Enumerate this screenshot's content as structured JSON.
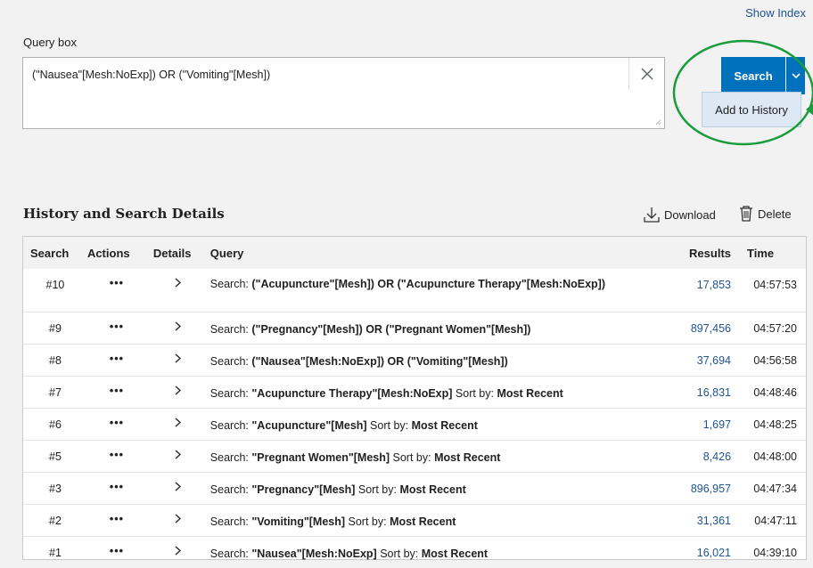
{
  "header": {
    "show_index": "Show Index"
  },
  "query": {
    "label": "Query box",
    "value": "(\"Nausea\"[Mesh:NoExp]) OR (\"Vomiting\"[Mesh])",
    "search_label": "Search",
    "add_to_history_label": "Add to History"
  },
  "history": {
    "title": "History and Search Details",
    "download_label": "Download",
    "delete_label": "Delete",
    "columns": [
      "Search",
      "Actions",
      "Details",
      "Query",
      "Results",
      "Time"
    ],
    "rows": [
      {
        "num": "#10",
        "actions": "•••",
        "prefix": "Search: ",
        "term": "(\"Acupuncture\"[Mesh]) OR (\"Acupuncture Therapy\"[Mesh:NoExp])",
        "sort_label": "",
        "sort_value": "",
        "results": "17,853",
        "time": "04:57:53"
      },
      {
        "num": "#9",
        "actions": "•••",
        "prefix": "Search: ",
        "term": "(\"Pregnancy\"[Mesh]) OR (\"Pregnant Women\"[Mesh])",
        "sort_label": "",
        "sort_value": "",
        "results": "897,456",
        "time": "04:57:20"
      },
      {
        "num": "#8",
        "actions": "•••",
        "prefix": "Search: ",
        "term": "(\"Nausea\"[Mesh:NoExp]) OR (\"Vomiting\"[Mesh])",
        "sort_label": "",
        "sort_value": "",
        "results": "37,694",
        "time": "04:56:58"
      },
      {
        "num": "#7",
        "actions": "•••",
        "prefix": "Search: ",
        "term": "\"Acupuncture Therapy\"[Mesh:NoExp]",
        "sort_label": " Sort by: ",
        "sort_value": "Most Recent",
        "results": "16,831",
        "time": "04:48:46"
      },
      {
        "num": "#6",
        "actions": "•••",
        "prefix": "Search: ",
        "term": "\"Acupuncture\"[Mesh]",
        "sort_label": " Sort by: ",
        "sort_value": "Most Recent",
        "results": "1,697",
        "time": "04:48:25"
      },
      {
        "num": "#5",
        "actions": "•••",
        "prefix": "Search: ",
        "term": "\"Pregnant Women\"[Mesh]",
        "sort_label": " Sort by: ",
        "sort_value": "Most Recent",
        "results": "8,426",
        "time": "04:48:00"
      },
      {
        "num": "#3",
        "actions": "•••",
        "prefix": "Search: ",
        "term": "\"Pregnancy\"[Mesh]",
        "sort_label": " Sort by: ",
        "sort_value": "Most Recent",
        "results": "896,957",
        "time": "04:47:34"
      },
      {
        "num": "#2",
        "actions": "•••",
        "prefix": "Search: ",
        "term": "\"Vomiting\"[Mesh]",
        "sort_label": " Sort by: ",
        "sort_value": "Most Recent",
        "results": "31,361",
        "time": "04:47:11"
      },
      {
        "num": "#1",
        "actions": "•••",
        "prefix": "Search: ",
        "term": "\"Nausea\"[Mesh:NoExp]",
        "sort_label": " Sort by: ",
        "sort_value": "Most Recent",
        "results": "16,021",
        "time": "04:39:10"
      }
    ]
  },
  "colors": {
    "primary": "#0071bc",
    "link": "#205493",
    "highlight_ring": "#1a9b3c",
    "dropdown_bg": "#dce9f5"
  },
  "icons": {
    "clear": "close-icon",
    "dropdown": "chevron-down-icon",
    "download": "download-icon",
    "delete": "trash-icon",
    "details": "chevron-right-icon"
  }
}
